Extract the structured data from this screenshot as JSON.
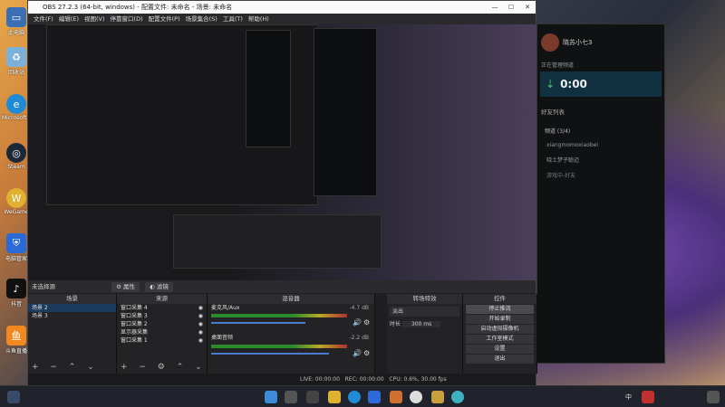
{
  "window": {
    "title": "OBS 27.2.3 (64-bit, windows) - 配置文件: 未命名 - 场景: 未命名"
  },
  "menu": [
    "文件(F)",
    "编辑(E)",
    "视图(V)",
    "停靠窗口(D)",
    "配置文件(P)",
    "场景集合(S)",
    "工具(T)",
    "帮助(H)"
  ],
  "desktop": [
    "此电脑",
    "回收站",
    "Microsoft Edge",
    "Steam",
    "WeGame",
    "电脑管家",
    "抖音",
    "斗鱼直播"
  ],
  "source_bar": {
    "label": "未选择源",
    "properties": "属性",
    "filters": "滤镜"
  },
  "scenes": {
    "header": "场景",
    "items": [
      "场景 2",
      "场景 3"
    ]
  },
  "sources": {
    "header": "来源",
    "items": [
      "窗口采集 4",
      "窗口采集 3",
      "窗口采集 2",
      "显示器采集",
      "窗口采集 1"
    ]
  },
  "mixer": {
    "header": "混音器",
    "tracks": [
      {
        "name": "麦克风/Aux",
        "db": "-4.7 dB"
      },
      {
        "name": "桌面音频",
        "db": "-2.2 dB"
      }
    ]
  },
  "transitions": {
    "header": "转场特效",
    "type": "淡出",
    "duration_label": "时长",
    "duration": "300 ms"
  },
  "controls": {
    "header": "控件",
    "buttons": [
      "停止推流",
      "开始录制",
      "启动虚拟摄像机",
      "工作室模式",
      "设置",
      "退出"
    ]
  },
  "status": {
    "live": "LIVE: 00:00:00",
    "rec": "REC: 00:00:00",
    "cpu": "CPU: 0.6%, 30.00 fps"
  },
  "chat": {
    "name": "晓苏小七3",
    "timer": "0:00",
    "room": "正在管理频道",
    "friends_header": "好友列表",
    "section": "频道 (3/4)",
    "users": [
      "xiangmomoxiaobei",
      "晓土梦子聪迈",
      "游戏中-好友"
    ]
  },
  "colors": {
    "accent": "#4a7bd0",
    "panel": "#232326"
  }
}
